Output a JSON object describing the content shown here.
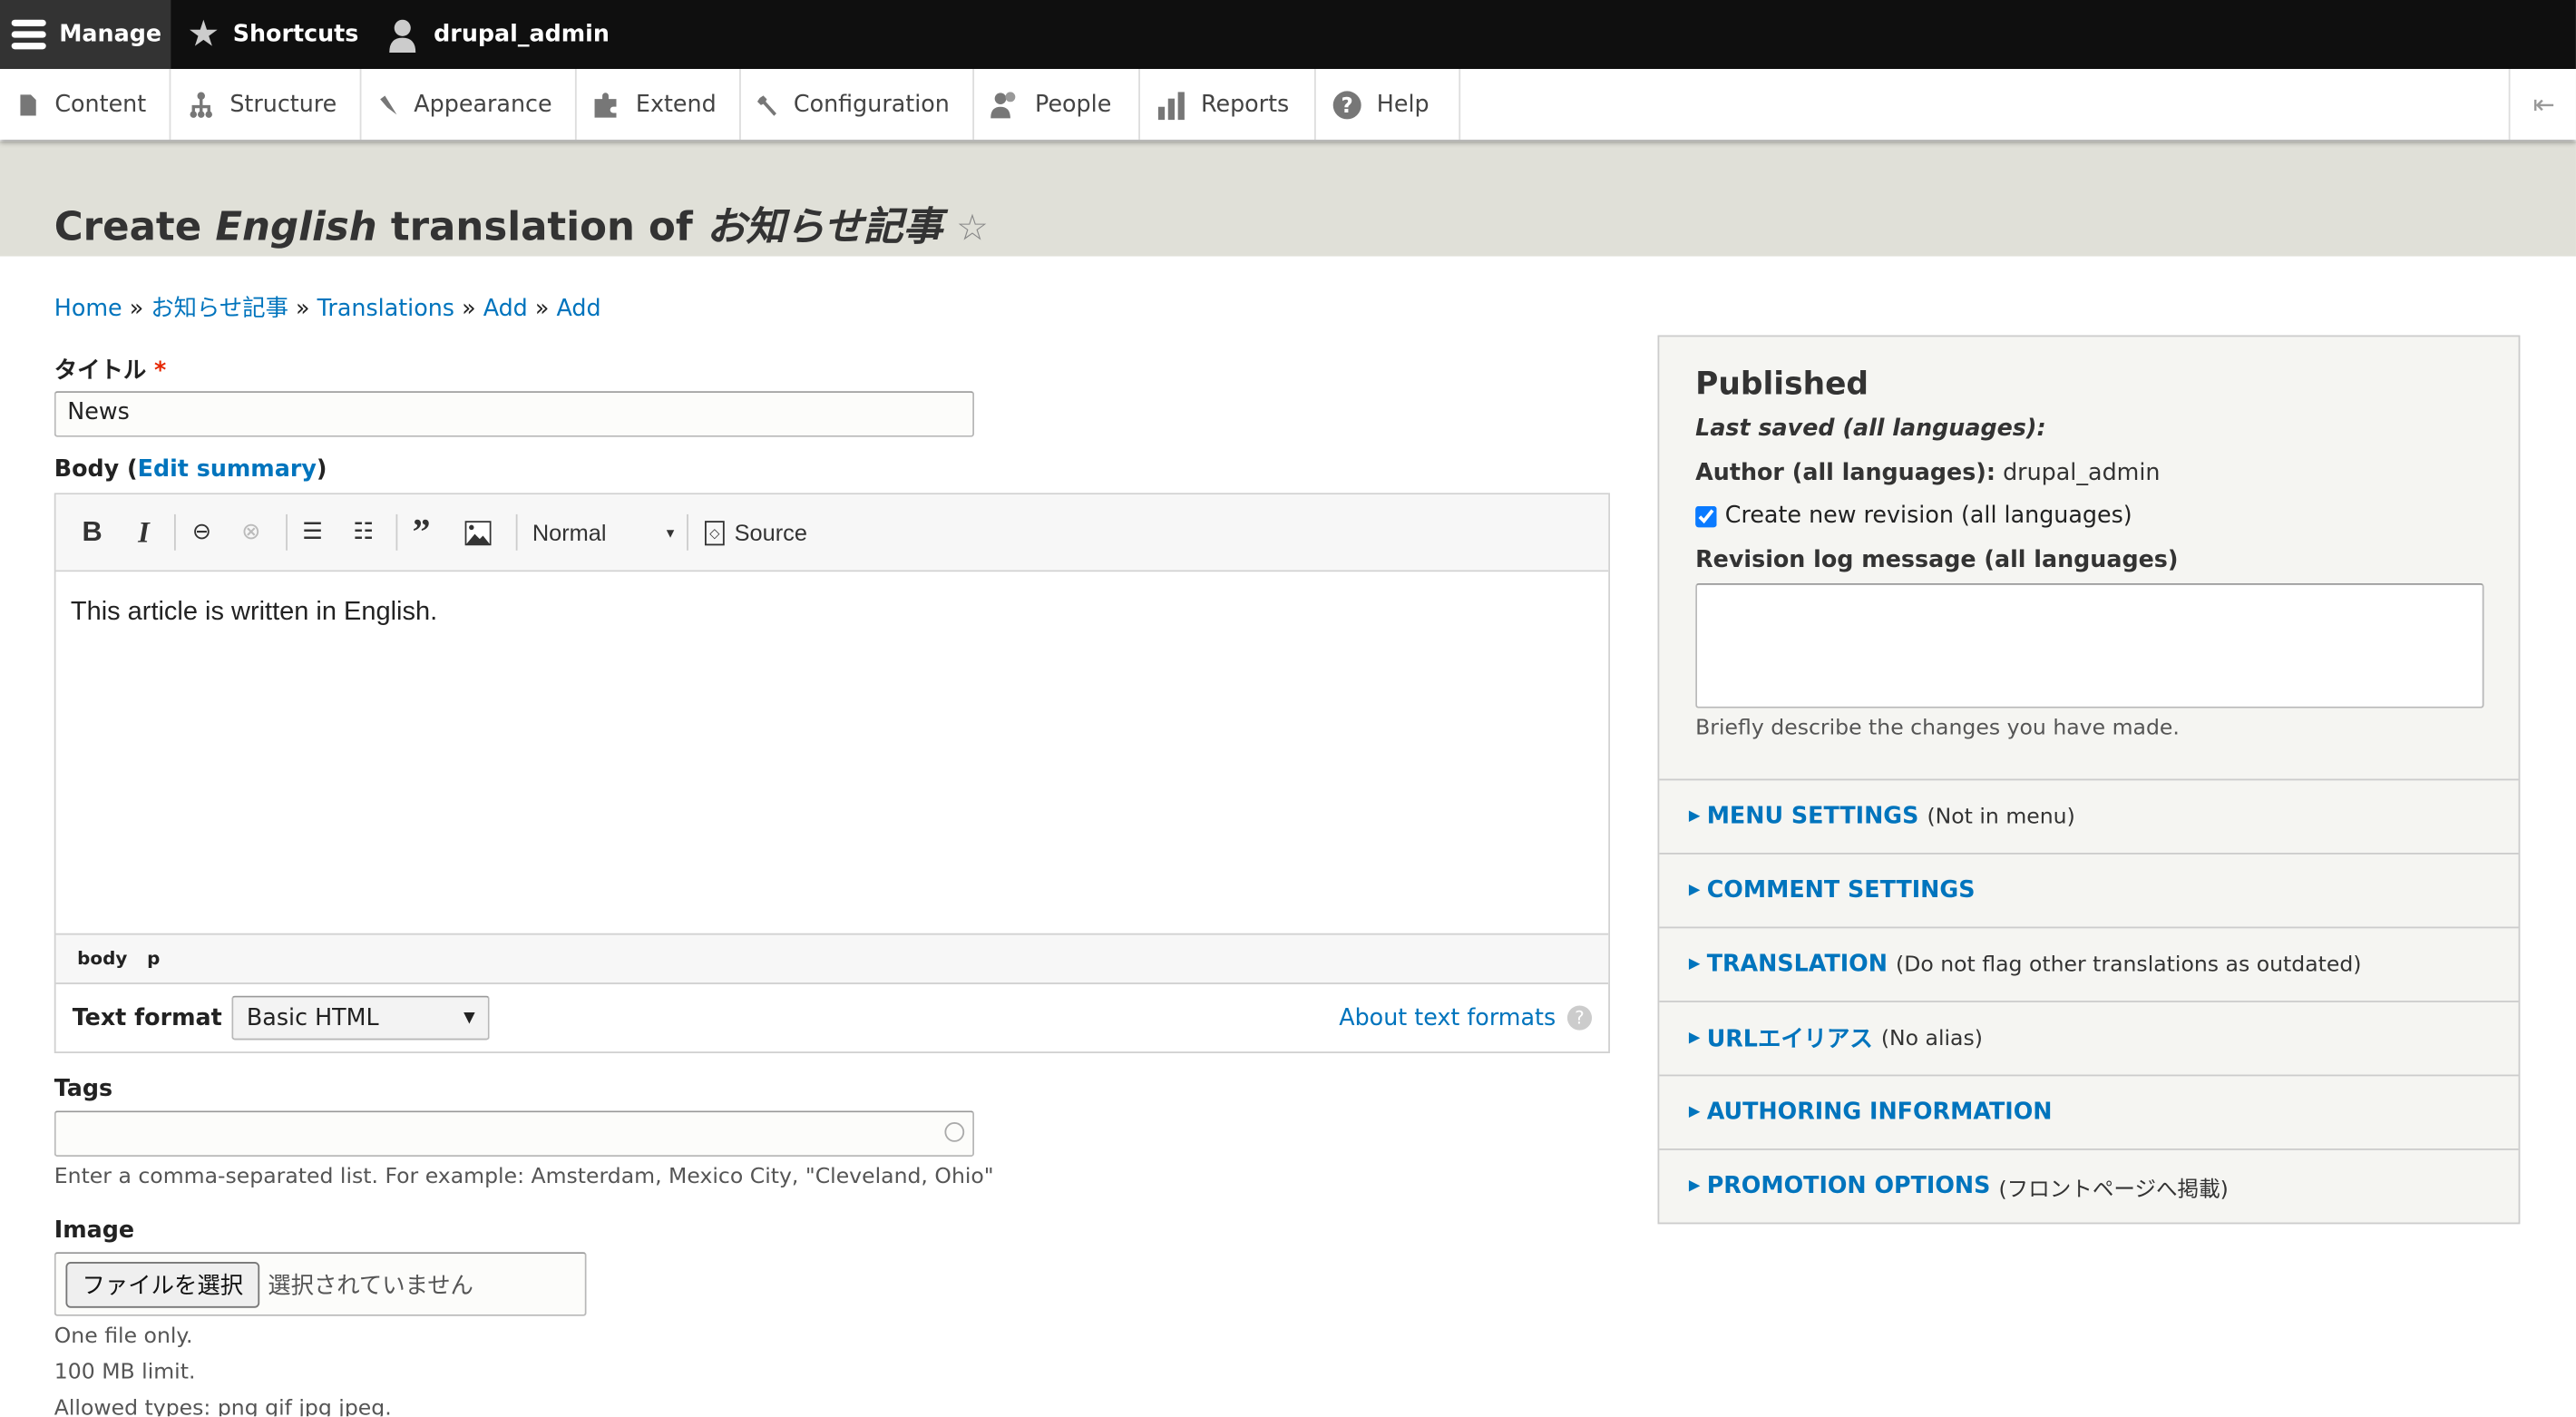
{
  "toolbar": {
    "manage": "Manage",
    "shortcuts": "Shortcuts",
    "user": "drupal_admin"
  },
  "tray": {
    "items": [
      "Content",
      "Structure",
      "Appearance",
      "Extend",
      "Configuration",
      "People",
      "Reports",
      "Help"
    ]
  },
  "page": {
    "title_prefix": "Create ",
    "title_lang": "English",
    "title_mid": " translation of ",
    "title_node": "お知らせ記事"
  },
  "breadcrumb": [
    "Home",
    "お知らせ記事",
    "Translations",
    "Add",
    "Add"
  ],
  "breadcrumb_sep": "»",
  "form": {
    "title_label": "タイトル",
    "required_mark": "*",
    "title_value": "News",
    "body_label": "Body",
    "edit_summary": "Edit summary",
    "editor": {
      "format_select": "Normal",
      "source": "Source",
      "content": "This article is written in English.",
      "path": [
        "body",
        "p"
      ]
    },
    "text_format_label": "Text format",
    "text_format_value": "Basic HTML",
    "about_formats": "About text formats",
    "tags_label": "Tags",
    "tags_value": "",
    "tags_help": "Enter a comma-separated list. For example: Amsterdam, Mexico City, \"Cleveland, Ohio\"",
    "image_label": "Image",
    "file_button": "ファイルを選択",
    "file_status": "選択されていません",
    "image_help": [
      "One file only.",
      "100 MB limit.",
      "Allowed types: png gif jpg jpeg."
    ]
  },
  "sidebar": {
    "status": "Published",
    "last_saved": "Last saved (all languages):",
    "author_label": "Author (all languages):",
    "author_value": "drupal_admin",
    "new_revision": "Create new revision (all languages)",
    "new_revision_checked": true,
    "revlog_label": "Revision log message (all languages)",
    "revlog_value": "",
    "revlog_help": "Briefly describe the changes you have made.",
    "details": [
      {
        "title": "MENU SETTINGS",
        "summary": "(Not in menu)"
      },
      {
        "title": "COMMENT SETTINGS",
        "summary": ""
      },
      {
        "title": "TRANSLATION",
        "summary": "(Do not flag other translations as outdated)"
      },
      {
        "title": "URLエイリアス",
        "summary": "(No alias)"
      },
      {
        "title": "AUTHORING INFORMATION",
        "summary": ""
      },
      {
        "title": "PROMOTION OPTIONS",
        "summary": "(フロントページへ掲載)"
      }
    ]
  },
  "colors": {
    "link": "#0074bd",
    "toolbar_bg": "#0f0f0f",
    "header_bg": "#e0e0d8",
    "required": "#e62600"
  }
}
